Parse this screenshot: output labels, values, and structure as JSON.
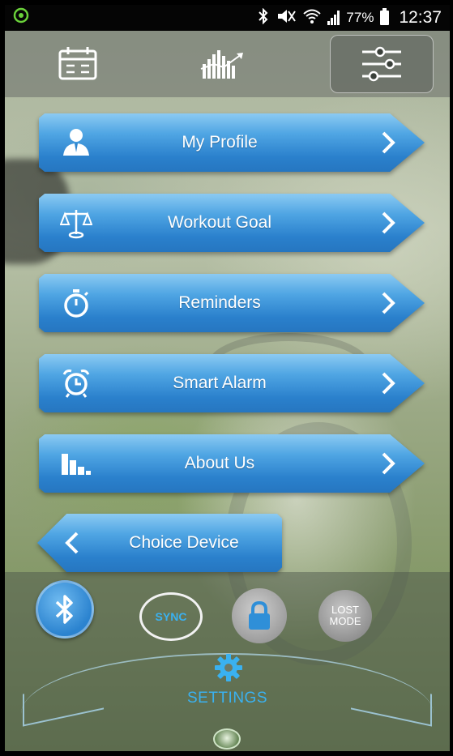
{
  "status_bar": {
    "battery": "77%",
    "time": "12:37"
  },
  "top_nav": {
    "tabs": [
      {
        "icon": "calendar-icon"
      },
      {
        "icon": "activity-chart-icon"
      },
      {
        "icon": "sliders-icon",
        "active": true
      }
    ]
  },
  "menu": {
    "items": [
      {
        "label": "My Profile",
        "icon": "profile-icon"
      },
      {
        "label": "Workout Goal",
        "icon": "scale-icon"
      },
      {
        "label": "Reminders",
        "icon": "stopwatch-icon"
      },
      {
        "label": "Smart Alarm",
        "icon": "alarm-clock-icon"
      },
      {
        "label": "About Us",
        "icon": "bar-chart-icon"
      }
    ],
    "back_item": {
      "label": "Choice Device",
      "icon": "chevron-left-icon"
    }
  },
  "bottom": {
    "sync_label": "SYNC",
    "lost_mode_line1": "LOST",
    "lost_mode_line2": "MODE",
    "settings_label": "SETTINGS"
  },
  "colors": {
    "accent": "#2f8fd8",
    "accent_text": "#3ab1f0",
    "status_green": "#6ad13a"
  }
}
